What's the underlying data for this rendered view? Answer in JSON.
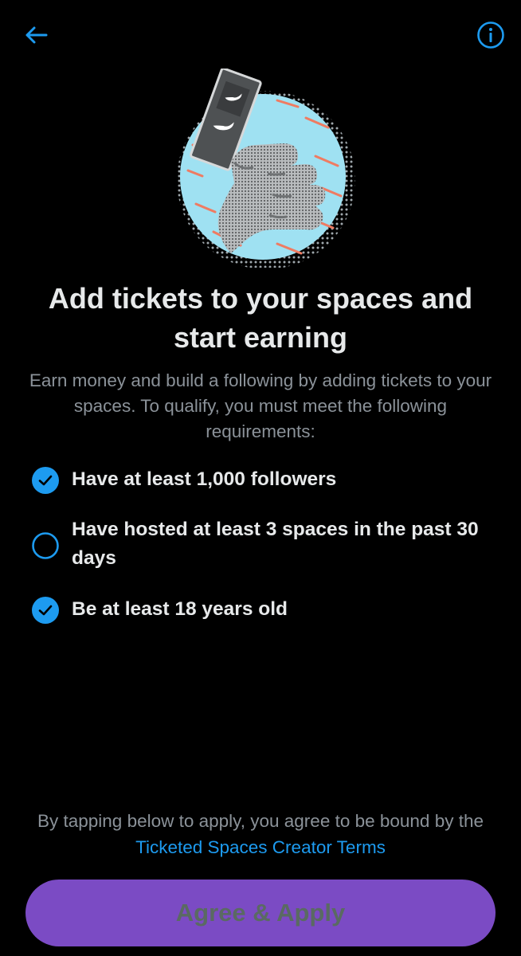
{
  "header": {
    "back_icon": "arrow-left-icon",
    "info_icon": "info-circle-icon",
    "accent_color": "#1d9bf0"
  },
  "hero": {
    "icon": "hand-holding-ticket-illustration"
  },
  "title": "Add tickets to your spaces and start earning",
  "subtitle": "Earn money and build a following by adding tickets to your spaces. To qualify, you must meet the following requirements:",
  "requirements": [
    {
      "label": "Have at least 1,000 followers",
      "met": true
    },
    {
      "label": "Have hosted at least 3 spaces in the past 30 days",
      "met": false
    },
    {
      "label": "Be at least 18 years old",
      "met": true
    }
  ],
  "terms": {
    "prefix": "By tapping below to apply, you agree to be bound by the ",
    "link_label": "Ticketed Spaces Creator Terms"
  },
  "cta": {
    "label": "Agree & Apply",
    "background": "#7b4bc4",
    "disabled": true
  }
}
